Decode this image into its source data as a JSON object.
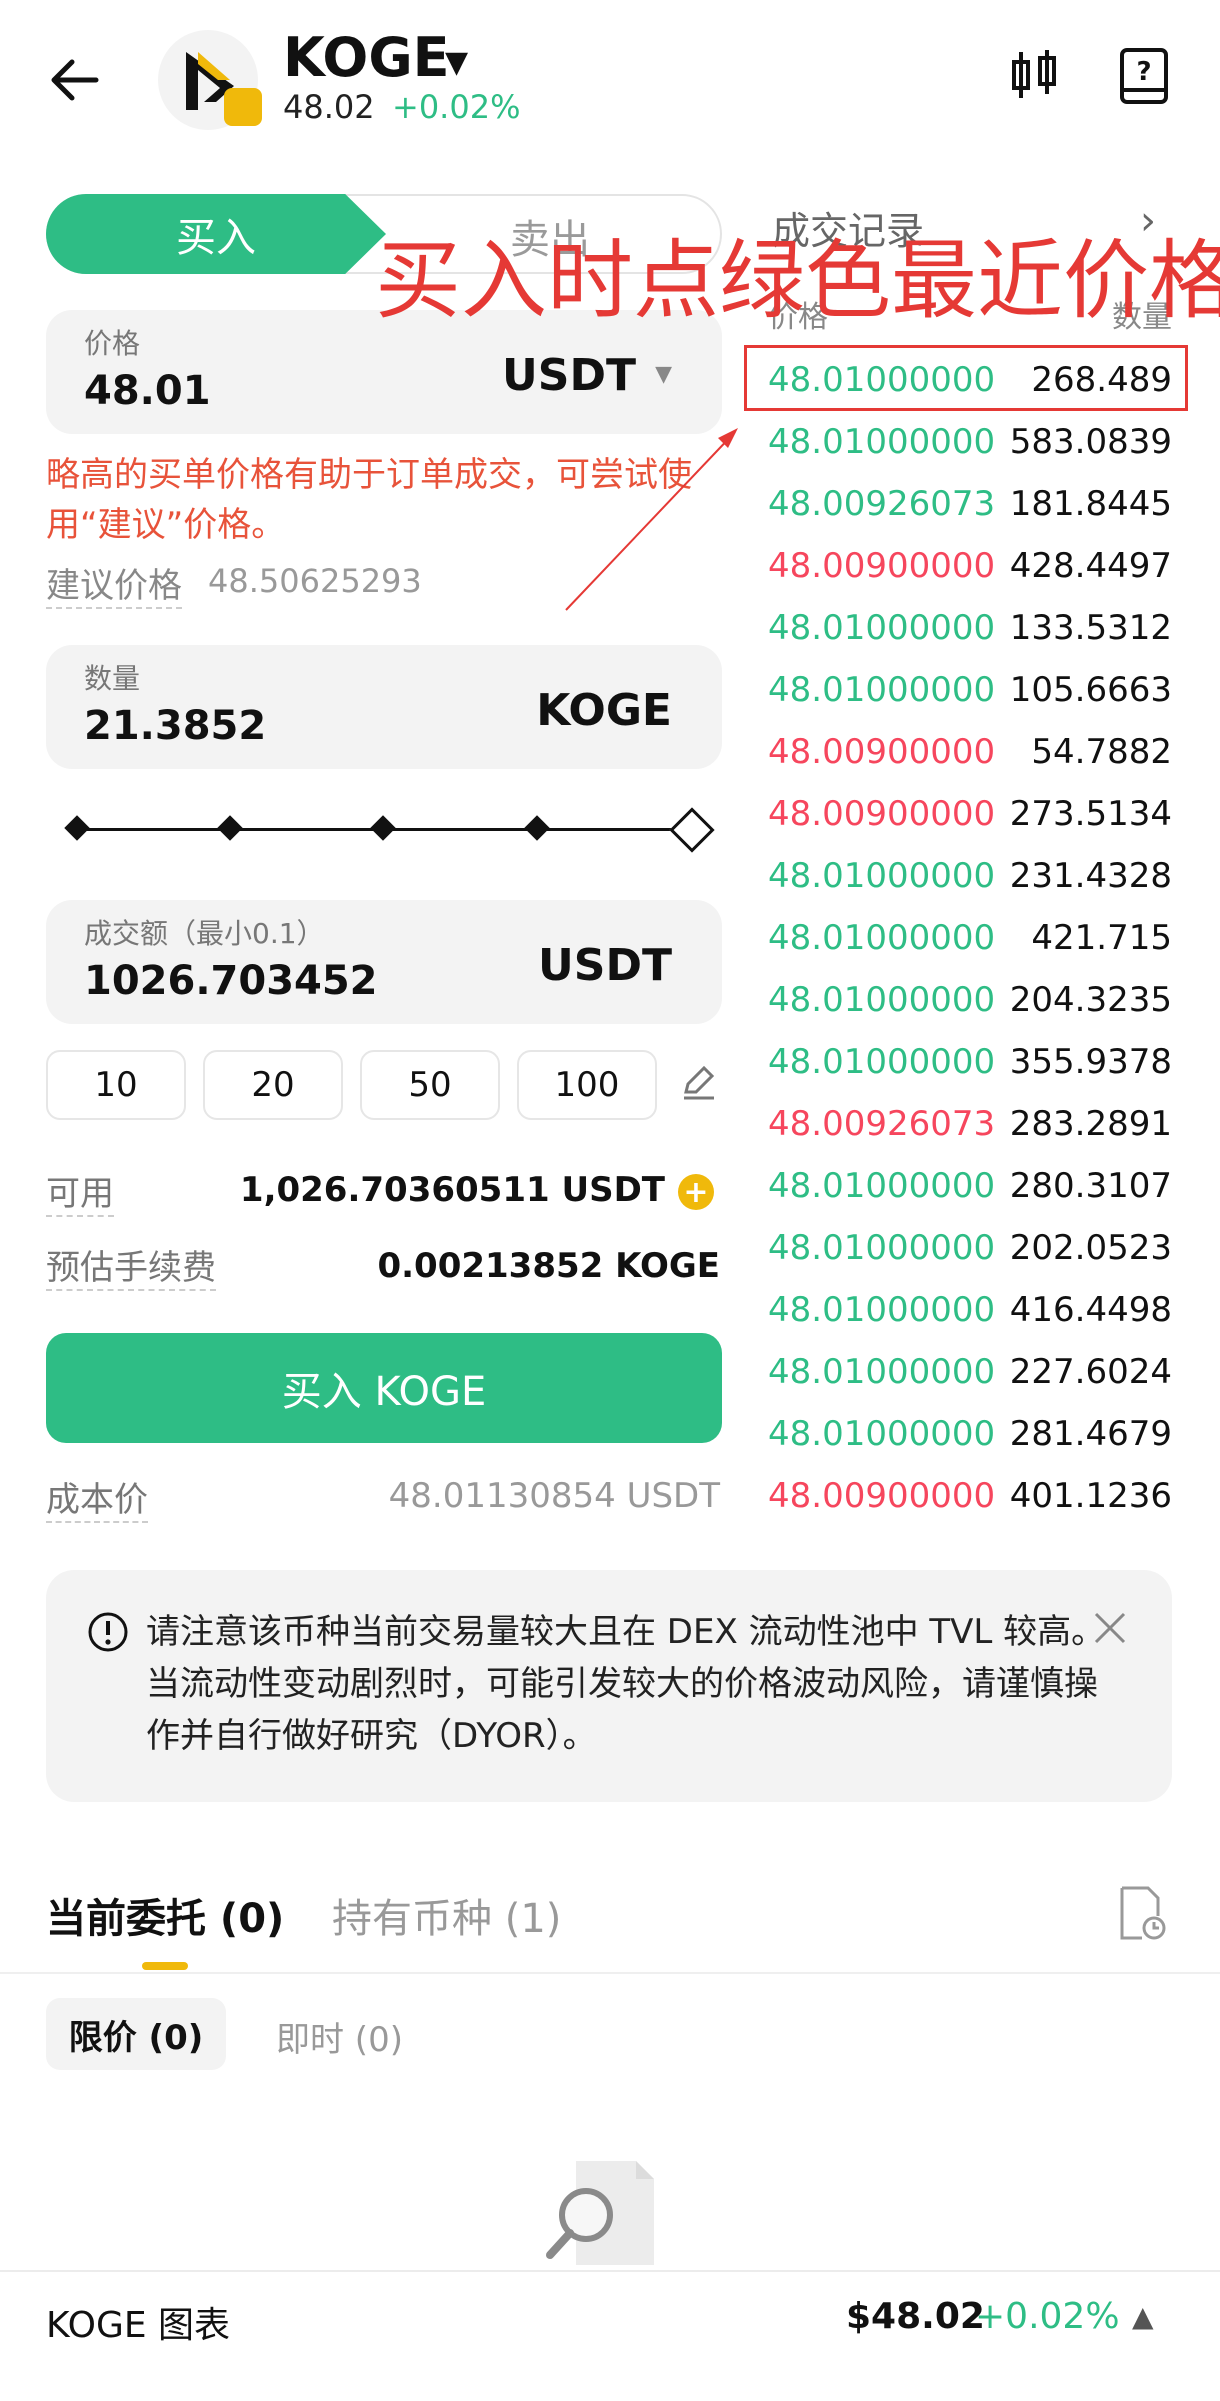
{
  "header": {
    "title": "KOGE",
    "price": "48.02",
    "change": "+0.02%"
  },
  "tabs": {
    "buy": "买入",
    "sell": "卖出"
  },
  "price_field": {
    "label": "价格",
    "value": "48.01",
    "unit": "USDT"
  },
  "price_hint": "略高的买单价格有助于订单成交，可尝试使用“建议”价格。",
  "suggested": {
    "label": "建议价格",
    "value": "48.50625293"
  },
  "qty_field": {
    "label": "数量",
    "value": "21.3852",
    "unit": "KOGE"
  },
  "slider": {
    "fraction": 1.0
  },
  "amount_field": {
    "label": "成交额（最小0.1）",
    "value": "1026.703452",
    "unit": "USDT"
  },
  "quick_amounts": [
    "10",
    "20",
    "50",
    "100"
  ],
  "available": {
    "label": "可用",
    "value": "1,026.70360511 USDT"
  },
  "fee": {
    "label": "预估手续费",
    "value": "0.00213852 KOGE"
  },
  "buy_button": "买入 KOGE",
  "cost": {
    "label": "成本价",
    "value": "48.01130854 USDT"
  },
  "trades": {
    "title": "成交记录",
    "col_price": "价格",
    "col_qty": "数量",
    "rows": [
      {
        "price": "48.01000000",
        "qty": "268.489",
        "side": "green"
      },
      {
        "price": "48.01000000",
        "qty": "583.0839",
        "side": "green"
      },
      {
        "price": "48.00926073",
        "qty": "181.8445",
        "side": "green"
      },
      {
        "price": "48.00900000",
        "qty": "428.4497",
        "side": "red"
      },
      {
        "price": "48.01000000",
        "qty": "133.5312",
        "side": "green"
      },
      {
        "price": "48.01000000",
        "qty": "105.6663",
        "side": "green"
      },
      {
        "price": "48.00900000",
        "qty": "54.7882",
        "side": "red"
      },
      {
        "price": "48.00900000",
        "qty": "273.5134",
        "side": "red"
      },
      {
        "price": "48.01000000",
        "qty": "231.4328",
        "side": "green"
      },
      {
        "price": "48.01000000",
        "qty": "421.715",
        "side": "green"
      },
      {
        "price": "48.01000000",
        "qty": "204.3235",
        "side": "green"
      },
      {
        "price": "48.01000000",
        "qty": "355.9378",
        "side": "green"
      },
      {
        "price": "48.00926073",
        "qty": "283.2891",
        "side": "red"
      },
      {
        "price": "48.01000000",
        "qty": "280.3107",
        "side": "green"
      },
      {
        "price": "48.01000000",
        "qty": "202.0523",
        "side": "green"
      },
      {
        "price": "48.01000000",
        "qty": "416.4498",
        "side": "green"
      },
      {
        "price": "48.01000000",
        "qty": "227.6024",
        "side": "green"
      },
      {
        "price": "48.01000000",
        "qty": "281.4679",
        "side": "green"
      },
      {
        "price": "48.00900000",
        "qty": "401.1236",
        "side": "red"
      }
    ]
  },
  "annotation": "买入时点绿色最近价格",
  "notice": "请注意该币种当前交易量较大且在 DEX 流动性池中 TVL 较高。当流动性变动剧烈时，可能引发较大的价格波动风险，请谨慎操作并自行做好研究（DYOR）。",
  "orders": {
    "tab_current": "当前委托 (0)",
    "tab_holdings": "持有币种 (1)",
    "chip_limit": "限价 (0)",
    "chip_instant": "即时 (0)"
  },
  "footer": {
    "label": "KOGE 图表",
    "price": "$48.02",
    "change": "+0.02%"
  },
  "colors": {
    "green": "#2ebd85",
    "red": "#f6465d",
    "gold": "#f0b90b",
    "annotation": "#e53935"
  }
}
